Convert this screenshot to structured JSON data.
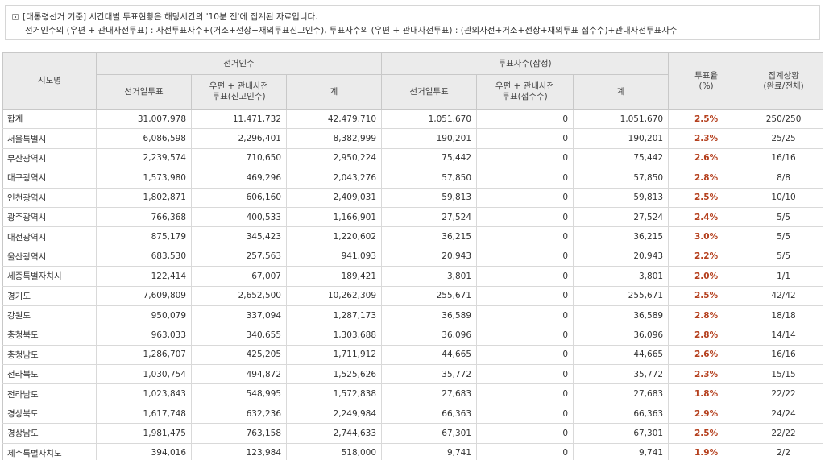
{
  "notice": {
    "line1": "[대통령선거 기준] 시간대별 투표현황은 해당시간의 '10분 전'에 집계된 자료입니다.",
    "line2": "선거인수의 (우편 + 관내사전투표) : 사전투표자수+(거소+선상+재외투표신고인수), 투표자수의 (우편 + 관내사전투표) : (관외사전+거소+선상+재외투표 접수수)+관내사전투표자수"
  },
  "headers": {
    "region": "시도명",
    "electors_group": "선거인수",
    "voters_group": "투표자수(잠정)",
    "rate": "투표율\n(%)",
    "status": "집계상황\n(완료/전체)",
    "electors": {
      "eday": "선거일투표",
      "postal": "우편 + 관내사전\n투표(신고인수)",
      "total": "계"
    },
    "voters": {
      "eday": "선거일투표",
      "postal": "우편 + 관내사전\n투표(접수수)",
      "total": "계"
    }
  },
  "rows": [
    {
      "region": "합계",
      "e_eday": "31,007,978",
      "e_postal": "11,471,732",
      "e_total": "42,479,710",
      "v_eday": "1,051,670",
      "v_postal": "0",
      "v_total": "1,051,670",
      "rate": "2.5%",
      "status": "250/250"
    },
    {
      "region": "서울특별시",
      "e_eday": "6,086,598",
      "e_postal": "2,296,401",
      "e_total": "8,382,999",
      "v_eday": "190,201",
      "v_postal": "0",
      "v_total": "190,201",
      "rate": "2.3%",
      "status": "25/25"
    },
    {
      "region": "부산광역시",
      "e_eday": "2,239,574",
      "e_postal": "710,650",
      "e_total": "2,950,224",
      "v_eday": "75,442",
      "v_postal": "0",
      "v_total": "75,442",
      "rate": "2.6%",
      "status": "16/16"
    },
    {
      "region": "대구광역시",
      "e_eday": "1,573,980",
      "e_postal": "469,296",
      "e_total": "2,043,276",
      "v_eday": "57,850",
      "v_postal": "0",
      "v_total": "57,850",
      "rate": "2.8%",
      "status": "8/8"
    },
    {
      "region": "인천광역시",
      "e_eday": "1,802,871",
      "e_postal": "606,160",
      "e_total": "2,409,031",
      "v_eday": "59,813",
      "v_postal": "0",
      "v_total": "59,813",
      "rate": "2.5%",
      "status": "10/10"
    },
    {
      "region": "광주광역시",
      "e_eday": "766,368",
      "e_postal": "400,533",
      "e_total": "1,166,901",
      "v_eday": "27,524",
      "v_postal": "0",
      "v_total": "27,524",
      "rate": "2.4%",
      "status": "5/5"
    },
    {
      "region": "대전광역시",
      "e_eday": "875,179",
      "e_postal": "345,423",
      "e_total": "1,220,602",
      "v_eday": "36,215",
      "v_postal": "0",
      "v_total": "36,215",
      "rate": "3.0%",
      "status": "5/5"
    },
    {
      "region": "울산광역시",
      "e_eday": "683,530",
      "e_postal": "257,563",
      "e_total": "941,093",
      "v_eday": "20,943",
      "v_postal": "0",
      "v_total": "20,943",
      "rate": "2.2%",
      "status": "5/5"
    },
    {
      "region": "세종특별자치시",
      "e_eday": "122,414",
      "e_postal": "67,007",
      "e_total": "189,421",
      "v_eday": "3,801",
      "v_postal": "0",
      "v_total": "3,801",
      "rate": "2.0%",
      "status": "1/1"
    },
    {
      "region": "경기도",
      "e_eday": "7,609,809",
      "e_postal": "2,652,500",
      "e_total": "10,262,309",
      "v_eday": "255,671",
      "v_postal": "0",
      "v_total": "255,671",
      "rate": "2.5%",
      "status": "42/42"
    },
    {
      "region": "강원도",
      "e_eday": "950,079",
      "e_postal": "337,094",
      "e_total": "1,287,173",
      "v_eday": "36,589",
      "v_postal": "0",
      "v_total": "36,589",
      "rate": "2.8%",
      "status": "18/18"
    },
    {
      "region": "충청북도",
      "e_eday": "963,033",
      "e_postal": "340,655",
      "e_total": "1,303,688",
      "v_eday": "36,096",
      "v_postal": "0",
      "v_total": "36,096",
      "rate": "2.8%",
      "status": "14/14"
    },
    {
      "region": "충청남도",
      "e_eday": "1,286,707",
      "e_postal": "425,205",
      "e_total": "1,711,912",
      "v_eday": "44,665",
      "v_postal": "0",
      "v_total": "44,665",
      "rate": "2.6%",
      "status": "16/16"
    },
    {
      "region": "전라북도",
      "e_eday": "1,030,754",
      "e_postal": "494,872",
      "e_total": "1,525,626",
      "v_eday": "35,772",
      "v_postal": "0",
      "v_total": "35,772",
      "rate": "2.3%",
      "status": "15/15"
    },
    {
      "region": "전라남도",
      "e_eday": "1,023,843",
      "e_postal": "548,995",
      "e_total": "1,572,838",
      "v_eday": "27,683",
      "v_postal": "0",
      "v_total": "27,683",
      "rate": "1.8%",
      "status": "22/22"
    },
    {
      "region": "경상북도",
      "e_eday": "1,617,748",
      "e_postal": "632,236",
      "e_total": "2,249,984",
      "v_eday": "66,363",
      "v_postal": "0",
      "v_total": "66,363",
      "rate": "2.9%",
      "status": "24/24"
    },
    {
      "region": "경상남도",
      "e_eday": "1,981,475",
      "e_postal": "763,158",
      "e_total": "2,744,633",
      "v_eday": "67,301",
      "v_postal": "0",
      "v_total": "67,301",
      "rate": "2.5%",
      "status": "22/22"
    },
    {
      "region": "제주특별자치도",
      "e_eday": "394,016",
      "e_postal": "123,984",
      "e_total": "518,000",
      "v_eday": "9,741",
      "v_postal": "0",
      "v_total": "9,741",
      "rate": "1.9%",
      "status": "2/2"
    }
  ],
  "colors": {
    "rate_text": "#b5401e",
    "header_bg": "#ebebeb"
  },
  "icons": {
    "notice_bullet": "square-bullet-icon"
  }
}
